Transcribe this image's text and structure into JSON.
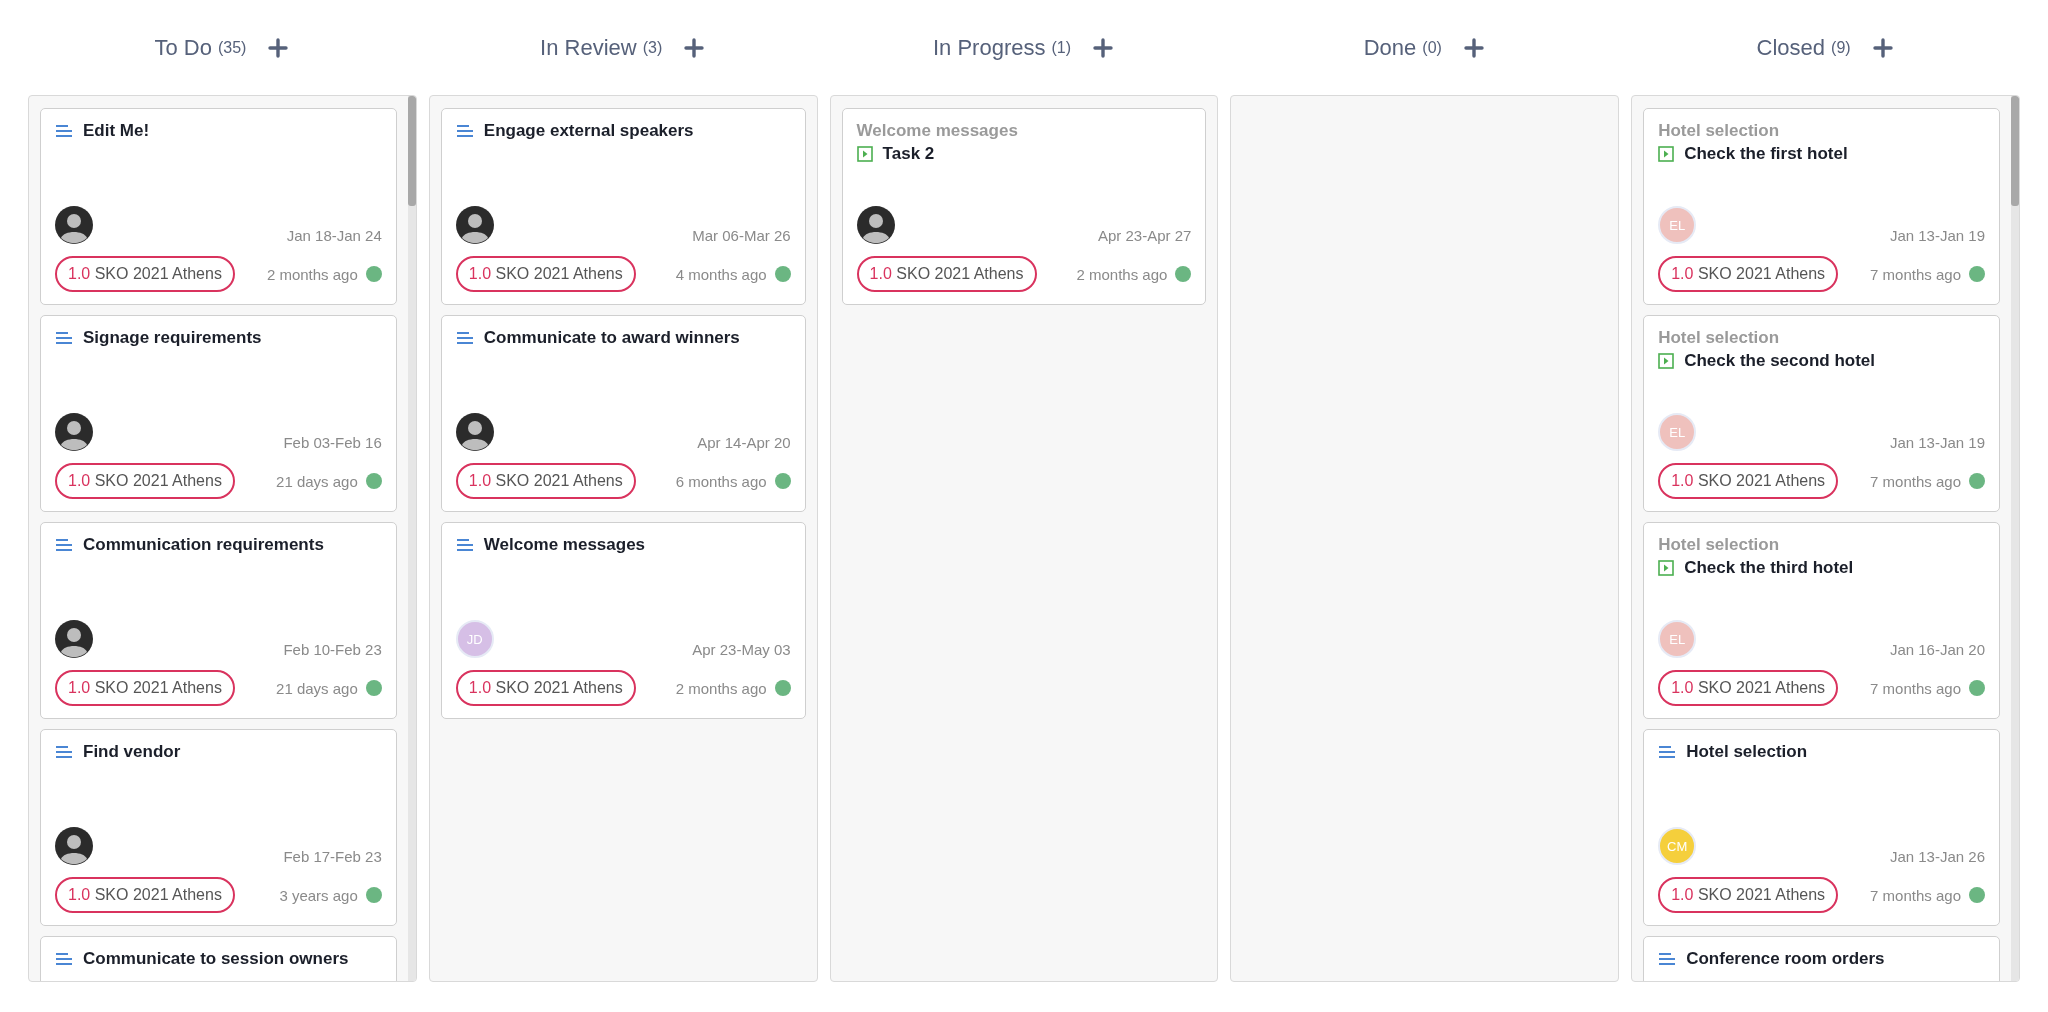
{
  "columns": [
    {
      "title": "To Do",
      "count": "(35)",
      "scrollbar": true,
      "cards": [
        {
          "kind": "task",
          "title": "Edit Me!",
          "avatar": {
            "kind": "photo"
          },
          "dates": "Jan 18-Jan 24",
          "tag": {
            "version": "1.0",
            "name": "SKO 2021 Athens"
          },
          "ago": "2 months ago",
          "color": "#6bb682"
        },
        {
          "kind": "task",
          "title": "Signage requirements",
          "avatar": {
            "kind": "photo"
          },
          "dates": "Feb 03-Feb 16",
          "tag": {
            "version": "1.0",
            "name": "SKO 2021 Athens"
          },
          "ago": "21 days ago",
          "color": "#6bb682"
        },
        {
          "kind": "task",
          "title": "Communication requirements",
          "avatar": {
            "kind": "photo"
          },
          "dates": "Feb 10-Feb 23",
          "tag": {
            "version": "1.0",
            "name": "SKO 2021 Athens"
          },
          "ago": "21 days ago",
          "color": "#6bb682"
        },
        {
          "kind": "task",
          "title": "Find vendor",
          "avatar": {
            "kind": "photo"
          },
          "dates": "Feb 17-Feb 23",
          "tag": {
            "version": "1.0",
            "name": "SKO 2021 Athens"
          },
          "ago": "3 years ago",
          "color": "#6bb682"
        },
        {
          "kind": "task",
          "title": "Communicate to session owners"
        }
      ]
    },
    {
      "title": "In Review",
      "count": "(3)",
      "scrollbar": false,
      "cards": [
        {
          "kind": "task",
          "title": "Engage external speakers",
          "avatar": {
            "kind": "photo"
          },
          "dates": "Mar 06-Mar 26",
          "tag": {
            "version": "1.0",
            "name": "SKO 2021 Athens"
          },
          "ago": "4 months ago",
          "color": "#6bb682"
        },
        {
          "kind": "task",
          "title": "Communicate to award winners",
          "avatar": {
            "kind": "photo"
          },
          "dates": "Apr 14-Apr 20",
          "tag": {
            "version": "1.0",
            "name": "SKO 2021 Athens"
          },
          "ago": "6 months ago",
          "color": "#6bb682"
        },
        {
          "kind": "task",
          "title": "Welcome messages",
          "avatar": {
            "kind": "initials",
            "initials": "JD",
            "color": "#d6bfe6"
          },
          "dates": "Apr 23-May 03",
          "tag": {
            "version": "1.0",
            "name": "SKO 2021 Athens"
          },
          "ago": "2 months ago",
          "color": "#6bb682"
        }
      ]
    },
    {
      "title": "In Progress",
      "count": "(1)",
      "scrollbar": false,
      "cards": [
        {
          "kind": "subtask",
          "parent": "Welcome messages",
          "title": "Task 2",
          "avatar": {
            "kind": "photo"
          },
          "dates": "Apr 23-Apr 27",
          "tag": {
            "version": "1.0",
            "name": "SKO 2021 Athens"
          },
          "ago": "2 months ago",
          "color": "#6bb682"
        }
      ]
    },
    {
      "title": "Done",
      "count": "(0)",
      "scrollbar": false
    },
    {
      "title": "Closed",
      "count": "(9)",
      "scrollbar": true,
      "cards": [
        {
          "kind": "subtask",
          "parent": "Hotel selection",
          "title": "Check the first hotel",
          "avatar": {
            "kind": "initials",
            "initials": "EL",
            "color": "#efc1bd"
          },
          "dates": "Jan 13-Jan 19",
          "tag": {
            "version": "1.0",
            "name": "SKO 2021 Athens"
          },
          "ago": "7 months ago",
          "color": "#6bb682"
        },
        {
          "kind": "subtask",
          "parent": "Hotel selection",
          "title": "Check the second hotel",
          "avatar": {
            "kind": "initials",
            "initials": "EL",
            "color": "#efc1bd"
          },
          "dates": "Jan 13-Jan 19",
          "tag": {
            "version": "1.0",
            "name": "SKO 2021 Athens"
          },
          "ago": "7 months ago",
          "color": "#6bb682"
        },
        {
          "kind": "subtask",
          "parent": "Hotel selection",
          "title": "Check the third hotel",
          "avatar": {
            "kind": "initials",
            "initials": "EL",
            "color": "#efc1bd"
          },
          "dates": "Jan 16-Jan 20",
          "tag": {
            "version": "1.0",
            "name": "SKO 2021 Athens"
          },
          "ago": "7 months ago",
          "color": "#6bb682"
        },
        {
          "kind": "task",
          "title": "Hotel selection",
          "avatar": {
            "kind": "initials",
            "initials": "CM",
            "color": "#f5cf3c"
          },
          "dates": "Jan 13-Jan 26",
          "tag": {
            "version": "1.0",
            "name": "SKO 2021 Athens"
          },
          "ago": "7 months ago",
          "color": "#6bb682"
        },
        {
          "kind": "task",
          "title": "Conference room orders"
        }
      ]
    }
  ]
}
